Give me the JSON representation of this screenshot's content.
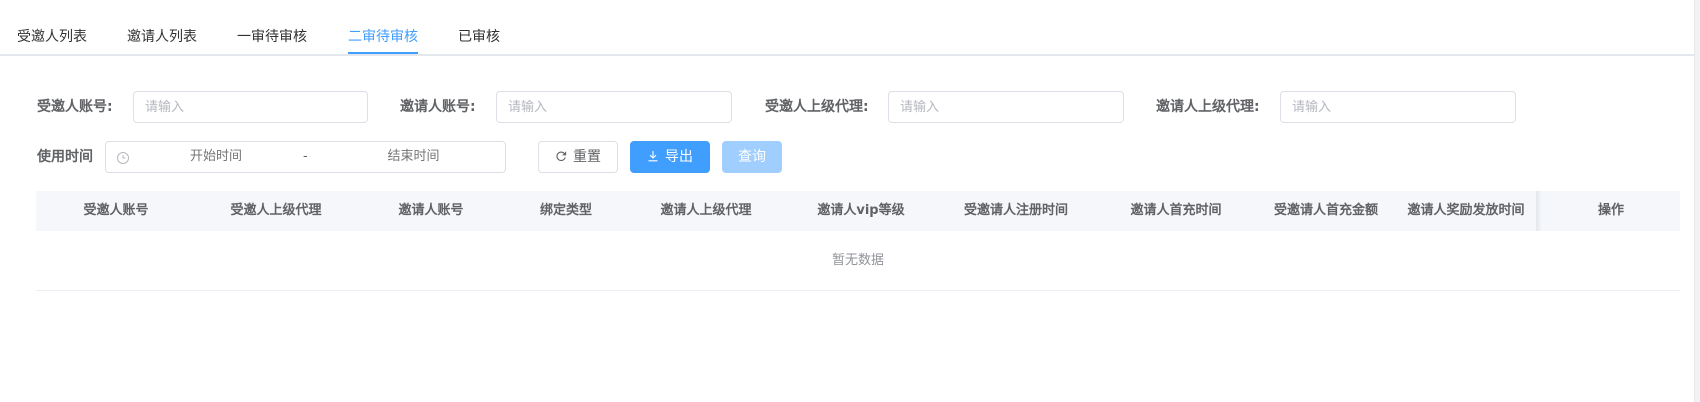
{
  "tabs": [
    {
      "label": "受邀人列表"
    },
    {
      "label": "邀请人列表"
    },
    {
      "label": "一审待审核"
    },
    {
      "label": "二审待审核",
      "active": true
    },
    {
      "label": "已审核"
    }
  ],
  "filters": {
    "invitee_account": {
      "label": "受邀人账号:",
      "placeholder": "请输入"
    },
    "inviter_account": {
      "label": "邀请人账号:",
      "placeholder": "请输入"
    },
    "invitee_superior_agent": {
      "label": "受邀人上级代理:",
      "placeholder": "请输入"
    },
    "inviter_superior_agent": {
      "label": "邀请人上级代理:",
      "placeholder": "请输入"
    },
    "use_time": {
      "label": "使用时间",
      "start_placeholder": "开始时间",
      "separator": "-",
      "end_placeholder": "结束时间"
    }
  },
  "buttons": {
    "reset": "重置",
    "export": "导出",
    "query": "查询"
  },
  "table": {
    "columns": [
      "受邀人账号",
      "受邀人上级代理",
      "邀请人账号",
      "绑定类型",
      "邀请人上级代理",
      "邀请人vip等级",
      "受邀请人注册时间",
      "邀请人首充时间",
      "受邀请人首充金额",
      "邀请人奖励发放时间",
      "操作"
    ],
    "rows": [],
    "empty_text": "暂无数据"
  },
  "colors": {
    "primary": "#409eff",
    "primary_light": "#a0cfff",
    "header_bg": "#f5f7fa",
    "border": "#dcdfe6"
  },
  "icons": {
    "clock": "clock-icon",
    "refresh": "refresh-icon",
    "download": "download-icon"
  }
}
